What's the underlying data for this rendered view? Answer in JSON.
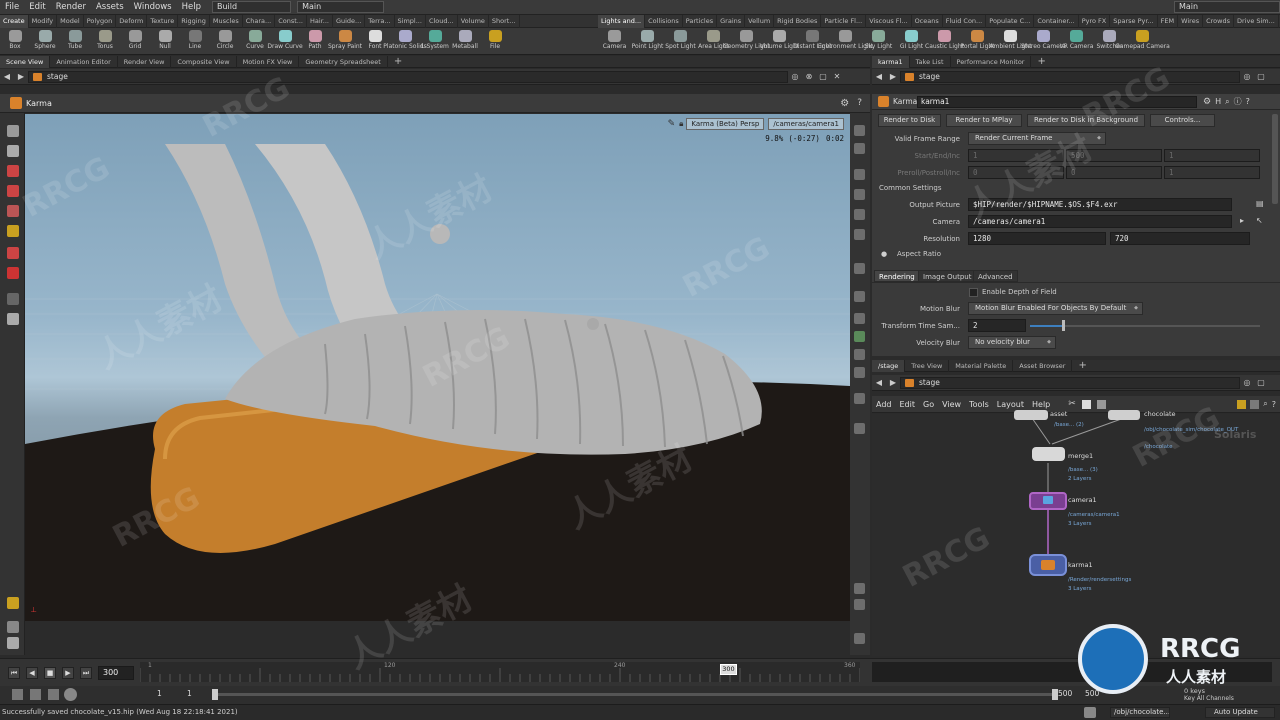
{
  "menu": {
    "items": [
      "File",
      "Edit",
      "Render",
      "Assets",
      "Windows",
      "Help"
    ],
    "desktop_build": "Build",
    "desktop_main": "Main",
    "right_main": "Main"
  },
  "shelf": {
    "tabs_left": [
      "Create",
      "Modify",
      "Model",
      "Polygon",
      "Deform",
      "Texture",
      "Rigging",
      "Muscles",
      "Chara...",
      "Const...",
      "Hair...",
      "Guide...",
      "Terra...",
      "Simpl...",
      "Cloud...",
      "Volume",
      "Short..."
    ],
    "tabs_right": [
      "Lights and...",
      "Collisions",
      "Particles",
      "Grains",
      "Vellum",
      "Rigid Bodies",
      "Particle Fl...",
      "Viscous Fl...",
      "Oceans",
      "Fluid Con...",
      "Populate C...",
      "Container...",
      "Pyro FX",
      "Sparse Pyr...",
      "FEM",
      "Wires",
      "Crowds",
      "Drive Sim..."
    ],
    "tools_left": [
      "Box",
      "Sphere",
      "Tube",
      "Torus",
      "Grid",
      "Null",
      "Line",
      "Circle",
      "Curve",
      "Draw Curve",
      "Path",
      "Spray Paint",
      "Font",
      "Platonic Solids",
      "L-System",
      "Metaball",
      "File"
    ],
    "tools_right": [
      "Camera",
      "Point Light",
      "Spot Light",
      "Area Light",
      "Geometry Light",
      "Volume Light",
      "Distant Light",
      "Environment Light",
      "Sky Light",
      "GI Light",
      "Caustic Light",
      "Portal Light",
      "Ambient Light",
      "Stereo Camera",
      "VR Camera",
      "Switcher",
      "Gamepad Camera"
    ]
  },
  "viewer": {
    "tabs": [
      "Scene View",
      "Animation Editor",
      "Render View",
      "Composite View",
      "Motion FX View",
      "Geometry Spreadsheet"
    ],
    "path": "stage",
    "title": "Karma",
    "renderer_menu": "Karma (Beta)  Persp",
    "camera_menu": "/cameras/camera1",
    "progress": "9.8%",
    "eta": "(-0:27)",
    "elapsed": "0:02"
  },
  "params": {
    "tabs": [
      "karma1",
      "Take List",
      "Performance Monitor"
    ],
    "path": "stage",
    "node_type": "Karma",
    "node_name": "karma1",
    "buttons": [
      "Render to Disk",
      "Render to MPlay",
      "Render to Disk in Background",
      "Controls..."
    ],
    "valid_frame_range_label": "Valid Frame Range",
    "valid_frame_range": "Render Current Frame",
    "start_end_label": "Start/End/Inc",
    "start_end": [
      "1",
      "500",
      "1"
    ],
    "preroll_label": "Preroll/Postroll/Inc",
    "preroll": [
      "0",
      "0",
      "1"
    ],
    "common_settings": "Common Settings",
    "output_label": "Output Picture",
    "output": "$HIP/render/$HIPNAME.$OS.$F4.exr",
    "camera_label": "Camera",
    "camera": "/cameras/camera1",
    "resolution_label": "Resolution",
    "res_x": "1280",
    "res_y": "720",
    "aspect_label": "Aspect Ratio",
    "sub_tabs": [
      "Rendering",
      "Image Output",
      "Advanced"
    ],
    "dof_label": "Enable Depth of Field",
    "motion_blur_label": "Motion Blur",
    "motion_blur": "Motion Blur Enabled For Objects By Default",
    "tsamples_label": "Transform Time Sam...",
    "tsamples": "2",
    "vblur_label": "Velocity Blur",
    "vblur": "No velocity blur"
  },
  "network": {
    "tabs": [
      "/stage",
      "Tree View",
      "Material Palette",
      "Asset Browser"
    ],
    "path": "stage",
    "menu": [
      "Add",
      "Edit",
      "Go",
      "View",
      "Tools",
      "Layout",
      "Help"
    ],
    "context_label": "Solaris",
    "nodes": {
      "asset": {
        "name": "asset",
        "sub": "/base... (2)"
      },
      "chocolate": {
        "name": "chocolate",
        "sub1": "/obj/chocolate_sim/chocolate_OUT",
        "sub2": "/chocolate"
      },
      "merge": {
        "name": "merge1",
        "sub1": "/base... (3)",
        "sub2": "2 Layers"
      },
      "camera": {
        "name": "camera1",
        "sub1": "/cameras/camera1",
        "sub2": "3 Layers"
      },
      "karma": {
        "name": "karma1",
        "sub1": "/Render/rendersettings",
        "sub2": "3 Layers"
      }
    }
  },
  "timeline": {
    "frame": "300",
    "ticks": [
      "1",
      "120",
      "240",
      "360"
    ],
    "current_marker": "300",
    "range_start": "1",
    "range_start2": "1",
    "range_end": "500",
    "range_end2": "500",
    "key_all_channels": "Key All Channels",
    "keys_label": "0 keys"
  },
  "status": {
    "message": "Successfully saved chocolate_v15.hip (Wed Aug 18 22:18:41 2021)",
    "obj_path": "/obj/chocolate...",
    "update_mode": "Auto Update"
  },
  "watermark": {
    "latin": "RRCG",
    "cjk": "人人素材"
  }
}
